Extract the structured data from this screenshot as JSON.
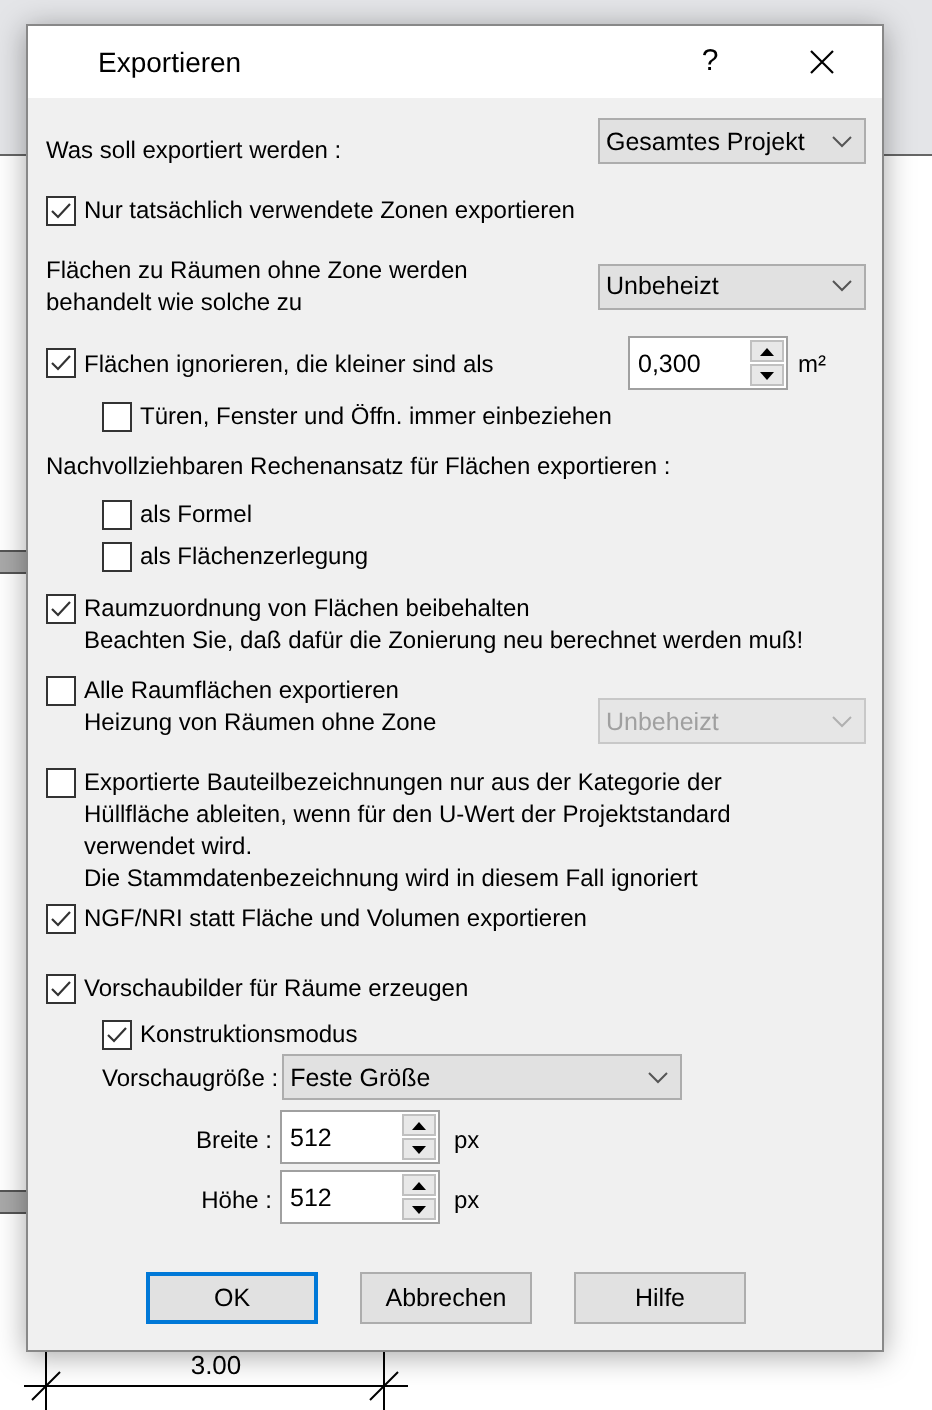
{
  "window": {
    "title": "Exportieren",
    "help": "?"
  },
  "export_scope": {
    "label": "Was soll exportiert werden :",
    "value": "Gesamtes Projekt"
  },
  "only_used_zones": {
    "label": "Nur tatsächlich verwendete Zonen exportieren",
    "checked": true
  },
  "unzoned_areas": {
    "label": "Flächen zu Räumen ohne Zone werden behandelt wie solche zu",
    "value": "Unbeheizt"
  },
  "ignore_small": {
    "label": "Flächen ignorieren, die kleiner sind als",
    "checked": true,
    "value": "0,300",
    "unit": "m²"
  },
  "include_openings": {
    "label": "Türen, Fenster und Öffn. immer einbeziehen",
    "checked": false
  },
  "calc_heading": "Nachvollziehbaren Rechenansatz für Flächen exportieren :",
  "calc_options": [
    {
      "label": "als Formel",
      "checked": false
    },
    {
      "label": "als Flächenzerlegung",
      "checked": false
    }
  ],
  "keep_room_assignment": {
    "label": "Raumzuordnung von Flächen beibehalten",
    "checked": true,
    "note": "Beachten Sie, daß dafür die Zonierung neu berechnet werden muß!"
  },
  "all_room_areas": {
    "label": "Alle Raumflächen exportieren",
    "checked": false,
    "heating_label": "Heizung von Räumen ohne Zone",
    "heating_value": "Unbeheizt",
    "heating_disabled": true
  },
  "derive_names": {
    "label": "Exportierte Bauteilbezeichnungen nur aus der Kategorie der Hüllfläche ableiten, wenn für den U-Wert der Projektstandard verwendet wird.",
    "checked": false,
    "note": "Die Stammdatenbezeichnung wird in diesem Fall ignoriert"
  },
  "ngf": {
    "label": "NGF/NRI statt Fläche und Volumen exportieren",
    "checked": true
  },
  "previews": {
    "label": "Vorschaubilder für Räume erzeugen",
    "checked": true,
    "construction_mode": {
      "label": "Konstruktionsmodus",
      "checked": true
    },
    "size_label": "Vorschaugröße :",
    "size_value": "Feste Größe",
    "width": {
      "label": "Breite :",
      "value": "512",
      "unit": "px"
    },
    "height": {
      "label": "Höhe :",
      "value": "512",
      "unit": "px"
    }
  },
  "buttons": [
    {
      "label": "OK",
      "default": true
    },
    {
      "label": "Abbrechen",
      "default": false
    },
    {
      "label": "Hilfe",
      "default": false
    }
  ],
  "background": {
    "dimension": "3.00"
  }
}
